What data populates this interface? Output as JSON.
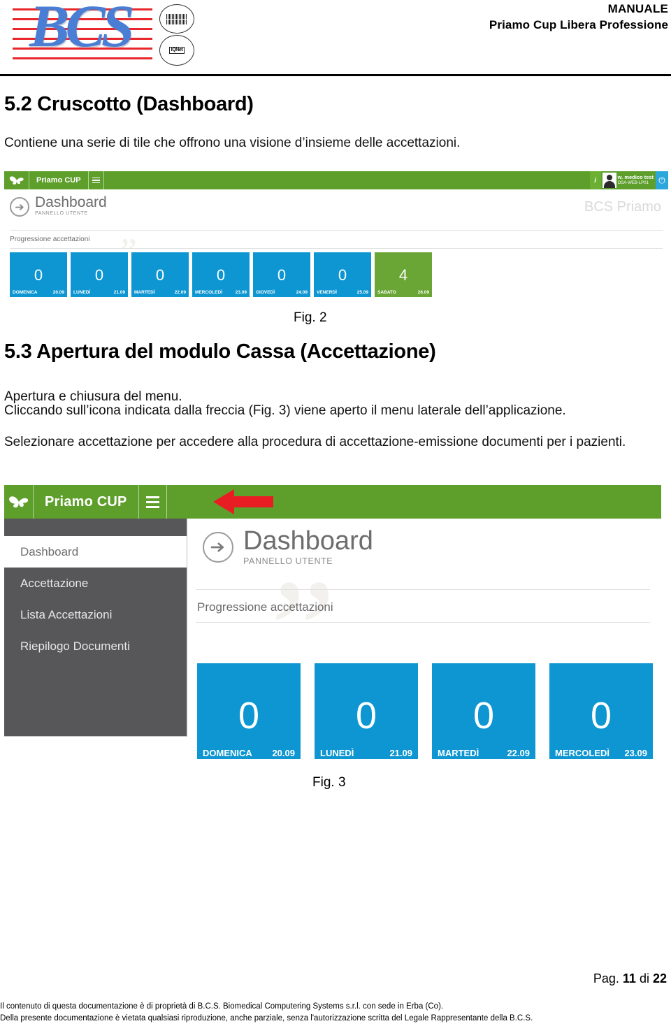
{
  "header": {
    "logo_text": "BCS",
    "seal_1_label": "IQNet",
    "seal_2_label": "IQNet",
    "manual_line1": "MANUALE",
    "manual_line2": "Priamo Cup Libera Professione"
  },
  "sections": {
    "s52_heading": "5.2 Cruscotto (Dashboard)",
    "s52_paragraph": "Contiene una serie di tile che offrono una visione d’insieme delle accettazioni.",
    "s53_heading": "5.3 Apertura del modulo Cassa (Accettazione)",
    "s53_p1": "Apertura e chiusura del menu.",
    "s53_p2": "Cliccando sull’icona indicata dalla freccia (Fig. 3) viene aperto il menu laterale dell’applicazione.",
    "s53_p3": "Selezionare accettazione per accedere alla procedura di accettazione-emissione documenti per i pazienti."
  },
  "captions": {
    "fig2": "Fig. 2",
    "fig3": "Fig. 3"
  },
  "fig2": {
    "appbar": {
      "brand": "Priamo CUP",
      "menu_icon": "hamburger-icon",
      "info_icon": "i",
      "user_name": "w. medico test",
      "user_host": "OSA-WEB-LP01",
      "power_icon": "⏻"
    },
    "panel": {
      "title": "Dashboard",
      "subtitle": "PANNELLO UTENTE",
      "brand_watermark": "BCS Priamo",
      "section_label": "Progressione accettazioni"
    },
    "tiles": [
      {
        "value": "0",
        "day": "DOMENICA",
        "date": "20.09",
        "color": "#0d96d2"
      },
      {
        "value": "0",
        "day": "LUNEDÌ",
        "date": "21.09",
        "color": "#0d96d2"
      },
      {
        "value": "0",
        "day": "MARTEDÌ",
        "date": "22.09",
        "color": "#0d96d2"
      },
      {
        "value": "0",
        "day": "MERCOLEDÌ",
        "date": "23.09",
        "color": "#0d96d2"
      },
      {
        "value": "0",
        "day": "GIOVEDÌ",
        "date": "24.09",
        "color": "#0d96d2"
      },
      {
        "value": "0",
        "day": "VENERDÌ",
        "date": "25.09",
        "color": "#0d96d2"
      },
      {
        "value": "4",
        "day": "SABATO",
        "date": "26.09",
        "color": "#6aa636"
      }
    ]
  },
  "fig3": {
    "appbar": {
      "brand": "Priamo CUP",
      "menu_icon": "hamburger-icon",
      "annotation_icon": "red-left-arrow"
    },
    "sidebar": [
      {
        "label": "Dashboard",
        "active": true
      },
      {
        "label": "Accettazione",
        "active": false
      },
      {
        "label": "Lista Accettazioni",
        "active": false
      },
      {
        "label": "Riepilogo Documenti",
        "active": false
      }
    ],
    "panel": {
      "title": "Dashboard",
      "subtitle": "PANNELLO UTENTE",
      "section_label": "Progressione accettazioni"
    },
    "tiles": [
      {
        "value": "0",
        "day": "DOMENICA",
        "date": "20.09",
        "color": "#0d96d2"
      },
      {
        "value": "0",
        "day": "LUNEDÌ",
        "date": "21.09",
        "color": "#0d96d2"
      },
      {
        "value": "0",
        "day": "MARTEDÌ",
        "date": "22.09",
        "color": "#0d96d2"
      },
      {
        "value": "0",
        "day": "MERCOLEDÌ",
        "date": "23.09",
        "color": "#0d96d2"
      }
    ]
  },
  "footer": {
    "page_prefix": "Pag.",
    "page_current": "11",
    "page_sep": "di",
    "page_total": "22",
    "note_line1": "Il contenuto di questa documentazione è di proprietà di B.C.S. Biomedical Computering Systems s.r.l. con sede in Erba (Co).",
    "note_line2": "Della presente documentazione è vietata qualsiasi riproduzione, anche parziale, senza l'autorizzazione scritta del Legale Rappresentante della B.C.S."
  },
  "colors": {
    "brand_green": "#5e9e2b",
    "tile_blue": "#0d96d2",
    "tile_green": "#6aa636",
    "sidebar_gray": "#57575a",
    "logo_red": "#e8262b",
    "logo_blue": "#4a7ed4",
    "arrow_red": "#e81c23"
  }
}
